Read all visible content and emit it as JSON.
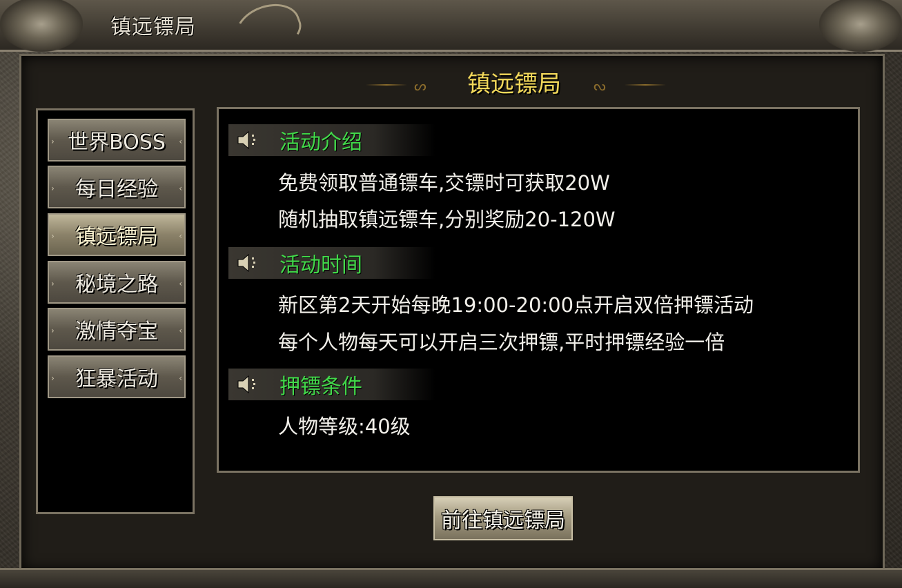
{
  "window": {
    "title": "镇远镖局"
  },
  "header": {
    "title": "镇远镖局",
    "swirl_left": "ᔕ",
    "swirl_right": "ᔓ"
  },
  "sidebar": {
    "items": [
      {
        "label": "世界BOSS",
        "active": false
      },
      {
        "label": "每日经验",
        "active": false
      },
      {
        "label": "镇远镖局",
        "active": true
      },
      {
        "label": "秘境之路",
        "active": false
      },
      {
        "label": "激情夺宝",
        "active": false
      },
      {
        "label": "狂暴活动",
        "active": false
      }
    ]
  },
  "content": {
    "sections": [
      {
        "title": "活动介绍",
        "lines": [
          "免费领取普通镖车,交镖时可获取20W",
          "随机抽取镇远镖车,分别奖励20-120W"
        ]
      },
      {
        "title": "活动时间",
        "lines": [
          "新区第2天开始每晚19:00-20:00点开启双倍押镖活动",
          "每个人物每天可以开启三次押镖,平时押镖经验一倍"
        ]
      },
      {
        "title": "押镖条件",
        "lines": [
          "人物等级:40级"
        ]
      }
    ]
  },
  "action": {
    "go_label": "前往镇远镖局"
  },
  "colors": {
    "section_title": "#42d84a",
    "header_title": "#f2d85a"
  },
  "icons": {
    "section": "speaker-icon",
    "side_arrow": "side-arrow-icon"
  }
}
